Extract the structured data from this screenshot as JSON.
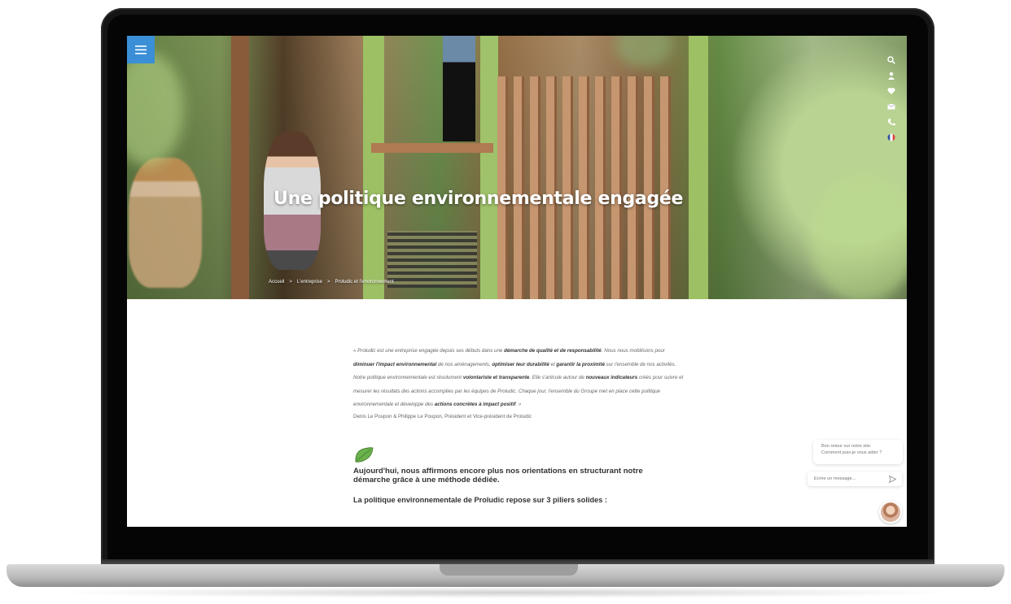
{
  "hero": {
    "title": "Une politique environnementale engagée",
    "breadcrumb": [
      {
        "label": "Accueil"
      },
      {
        "label": "L'entreprise"
      },
      {
        "label": "Proludic et l'environnement"
      }
    ],
    "breadcrumb_separator": ">",
    "side_icons": [
      "search-icon",
      "user-icon",
      "heart-icon",
      "mail-icon",
      "phone-icon",
      "france-flag-icon"
    ]
  },
  "menu": {
    "icon": "hamburger-icon",
    "accent": "#3a8fd6"
  },
  "content": {
    "quote_parts": [
      "« Proludic est une entreprise engagée depuis ses débuts dans une ",
      "démarche de qualité et de responsabilité",
      ". Nous nous mobilisons pour ",
      "diminuer l'impact environnemental",
      " de nos aménagements, ",
      "optimiser leur durabilité",
      " et ",
      "garantir la proximité",
      " sur l'ensemble de nos activités. Notre politique environnementale est résolument ",
      "volontariste et transparente",
      ". Elle s'articule autour de ",
      "nouveaux indicateurs",
      " créés pour suivre et mesurer les résultats des actions accomplies par les équipes de Proludic. Chaque jour, l'ensemble du Groupe met en place cette politique environnementale et développe des ",
      "actions concrètes à impact positif",
      ". »"
    ],
    "signature": "Denis Le Poupon & Philippe Le Poupon, Président et Vice-président de Proludic",
    "leaf_icon": "leaf-icon",
    "headline": "Aujourd'hui, nous affirmons encore plus nos orientations en structurant notre démarche grâce à une méthode dédiée.",
    "subhead": "La politique environnementale de Proludic repose sur 3 piliers solides :"
  },
  "chat": {
    "greeting_line1": "Bon retour sur notre site.",
    "greeting_line2": "Comment puis-je vous aider ?",
    "input_placeholder": "Écrire un message...",
    "send_icon": "send-icon",
    "avatar": "agent-avatar"
  }
}
